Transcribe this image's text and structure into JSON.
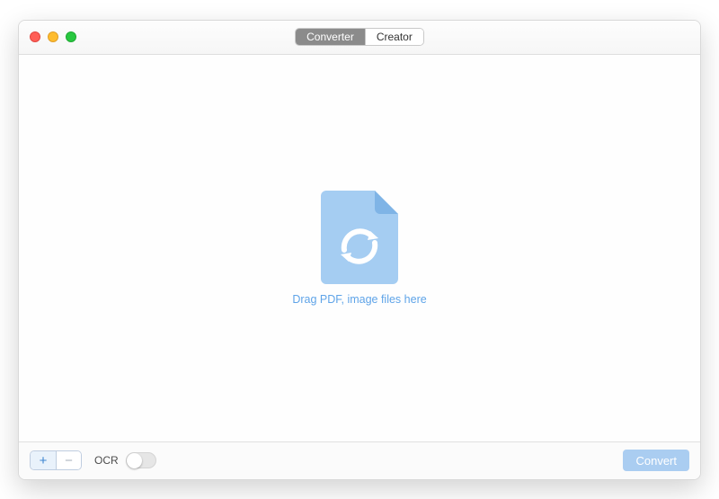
{
  "tabs": {
    "converter": "Converter",
    "creator": "Creator"
  },
  "dropzone": {
    "hint": "Drag PDF, image files here"
  },
  "footer": {
    "add_label": "+",
    "remove_label": "−",
    "ocr_label": "OCR",
    "convert_label": "Convert"
  },
  "colors": {
    "accent": "#3d85d1",
    "file_icon": "#a5cdf2"
  }
}
